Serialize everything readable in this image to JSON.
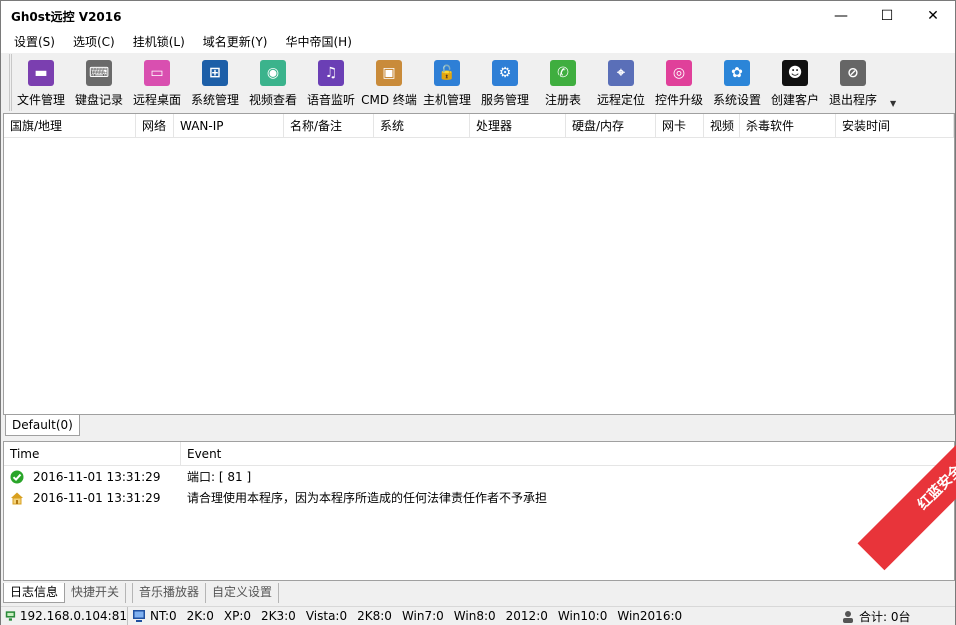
{
  "window": {
    "title": "Gh0st远控 V2016",
    "min_glyph": "—",
    "max_glyph": "☐",
    "close_glyph": "✕"
  },
  "menu": [
    "设置(S)",
    "选项(C)",
    "挂机锁(L)",
    "域名更新(Y)",
    "华中帝国(H)"
  ],
  "toolbar": [
    {
      "label": "文件管理",
      "icon": "folder-icon",
      "color": "#7b3fb0",
      "glyph": "▬"
    },
    {
      "label": "键盘记录",
      "icon": "keyboard-icon",
      "color": "#6a6a6a",
      "glyph": "⌨"
    },
    {
      "label": "远程桌面",
      "icon": "monitor-icon",
      "color": "#d94fb0",
      "glyph": "▭"
    },
    {
      "label": "系统管理",
      "icon": "windows-icon",
      "color": "#1d5fa8",
      "glyph": "⊞"
    },
    {
      "label": "视频查看",
      "icon": "camera-icon",
      "color": "#3bb38c",
      "glyph": "◉"
    },
    {
      "label": "语音监听",
      "icon": "music-icon",
      "color": "#6b3fb5",
      "glyph": "♫"
    },
    {
      "label": "CMD 终端",
      "icon": "terminal-icon",
      "color": "#c98b3a",
      "glyph": "▣"
    },
    {
      "label": "主机管理",
      "icon": "lock-icon",
      "color": "#2e7fd6",
      "glyph": "🔓"
    },
    {
      "label": "服务管理",
      "icon": "services-icon",
      "color": "#2e7fd6",
      "glyph": "⚙"
    },
    {
      "label": "注册表",
      "icon": "registry-icon",
      "color": "#3fae3f",
      "glyph": "✆"
    },
    {
      "label": "远程定位",
      "icon": "location-icon",
      "color": "#5a6fb8",
      "glyph": "⌖"
    },
    {
      "label": "控件升级",
      "icon": "upgrade-icon",
      "color": "#e0409a",
      "glyph": "◎"
    },
    {
      "label": "系统设置",
      "icon": "settings-icon",
      "color": "#2b85d8",
      "glyph": "✿"
    },
    {
      "label": "创建客户",
      "icon": "user-icon",
      "color": "#111111",
      "glyph": "☻"
    },
    {
      "label": "退出程序",
      "icon": "exit-icon",
      "color": "#666666",
      "glyph": "⊘"
    }
  ],
  "client_columns": [
    "国旗/地理",
    "网络",
    "WAN-IP",
    "名称/备注",
    "系统",
    "处理器",
    "硬盘/内存",
    "网卡",
    "视频",
    "杀毒软件",
    "安装时间"
  ],
  "group_tab": "Default(0)",
  "log_columns": [
    "Time",
    "Event"
  ],
  "log_rows": [
    {
      "time": "2016-11-01 13:31:29",
      "event": "端口: [ 81 ]",
      "icon": "check-icon",
      "color": "#2aa52a"
    },
    {
      "time": "2016-11-01 13:31:29",
      "event": "请合理使用本程序，因为本程序所造成的任何法律责任作者不予承担",
      "icon": "home-icon",
      "color": "#d8a020"
    }
  ],
  "bottom_tabs": [
    "日志信息",
    "快捷开关",
    "",
    "音乐播放器",
    "自定义设置"
  ],
  "status": {
    "ip": "192.168.0.104:81",
    "os_counts": [
      "NT:0",
      "2K:0",
      "XP:0",
      "2K3:0",
      "Vista:0",
      "2K8:0",
      "Win7:0",
      "Win8:0",
      "2012:0",
      "Win10:0",
      "Win2016:0"
    ],
    "total": "合计: 0台"
  },
  "watermark": {
    "text": "红蓝安全网"
  }
}
